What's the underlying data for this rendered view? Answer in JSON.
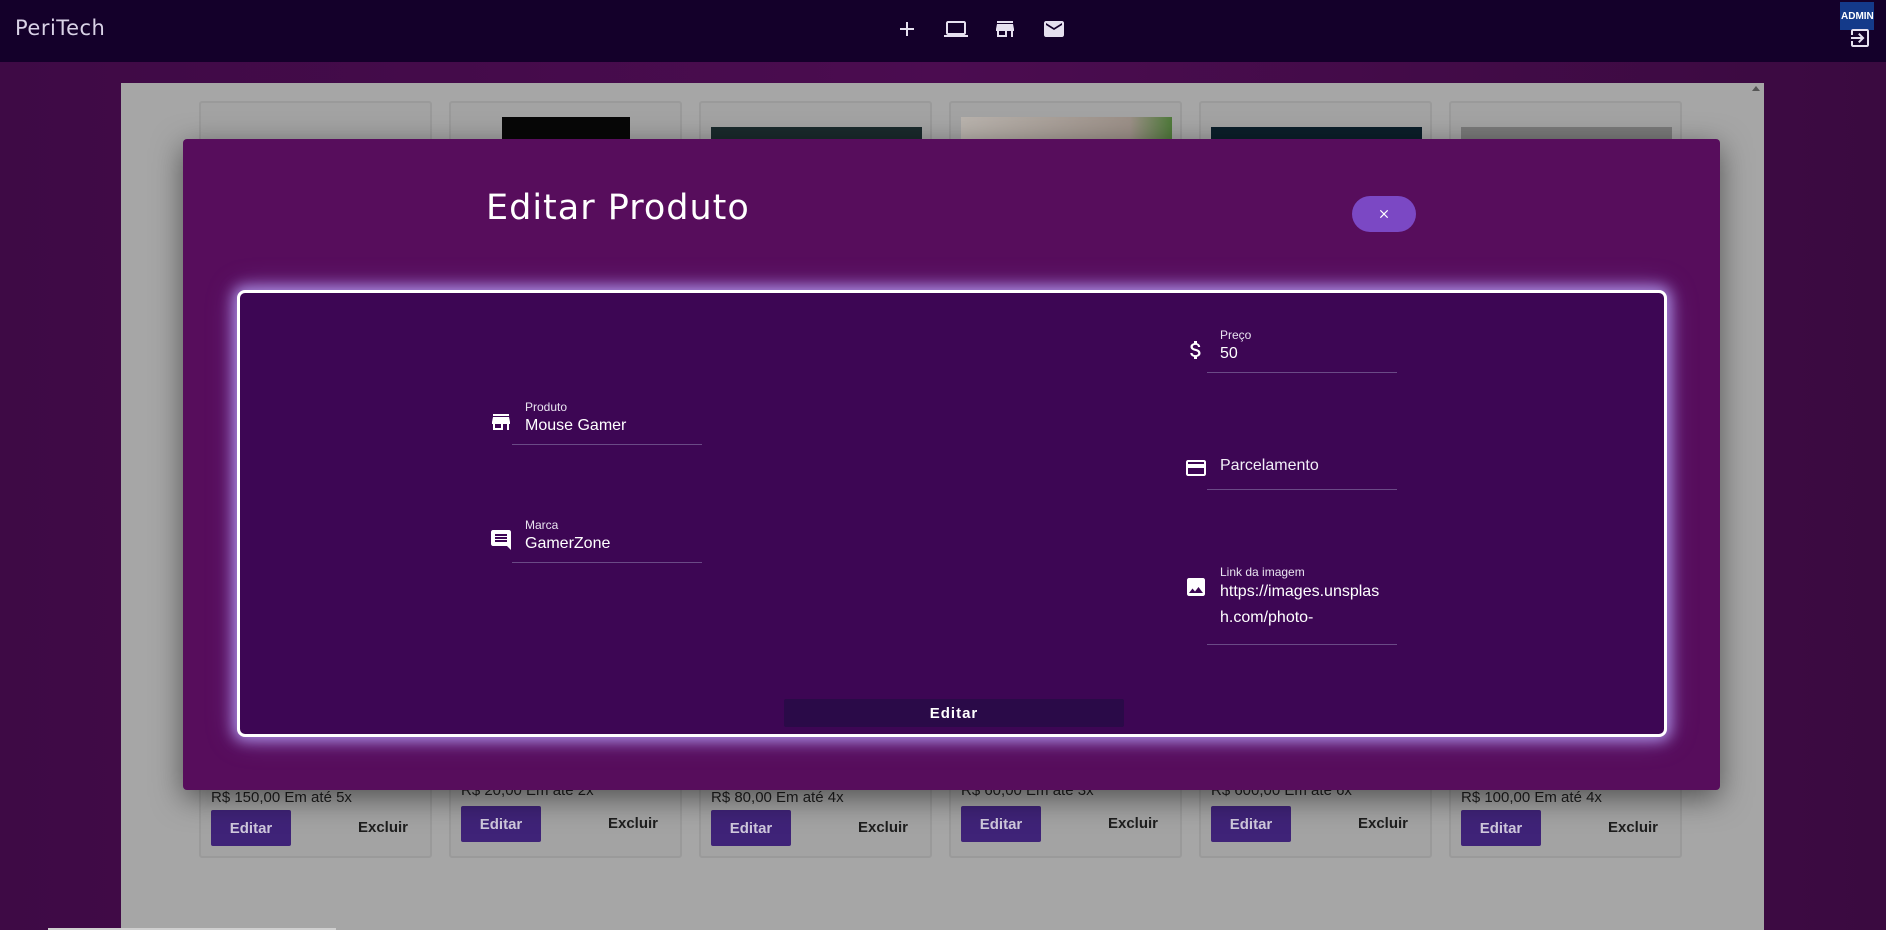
{
  "header": {
    "brand": "PeriTech",
    "nav_icons": [
      "add-icon",
      "laptop-icon",
      "store-icon",
      "mail-icon"
    ],
    "admin_badge": "ADMIN",
    "logout_icon": "logout-icon"
  },
  "products": [
    {
      "price_text": "R$ 150,00 Em até 5x",
      "edit_label": "Editar",
      "delete_label": "Excluir"
    },
    {
      "price_text": "R$ 20,00 Em até 2x",
      "edit_label": "Editar",
      "delete_label": "Excluir"
    },
    {
      "price_text": "R$ 80,00 Em até 4x",
      "edit_label": "Editar",
      "delete_label": "Excluir"
    },
    {
      "price_text": "R$ 60,00 Em até 3x",
      "edit_label": "Editar",
      "delete_label": "Excluir"
    },
    {
      "price_text": "R$ 600,00 Em até 6x",
      "edit_label": "Editar",
      "delete_label": "Excluir"
    },
    {
      "price_text": "R$ 100,00 Em até 4x",
      "edit_label": "Editar",
      "delete_label": "Excluir"
    }
  ],
  "modal": {
    "title": "Editar Produto",
    "close_icon": "close-icon",
    "fields": {
      "produto": {
        "label": "Produto",
        "value": "Mouse Gamer",
        "icon": "store-icon"
      },
      "marca": {
        "label": "Marca",
        "value": "GamerZone",
        "icon": "comment-icon"
      },
      "preco": {
        "label": "Preço",
        "value": "50",
        "icon": "dollar-icon"
      },
      "parcelamento": {
        "placeholder": "Parcelamento",
        "icon": "credit-card-icon"
      },
      "imagem": {
        "label": "Link da imagem",
        "value": "https://images.unsplash.com/photo-",
        "icon": "image-icon"
      }
    },
    "submit_label": "Editar"
  },
  "colors": {
    "topbar": "#14002a",
    "modal_bg": "#570d5c",
    "form_bg": "#3d0654",
    "close_button": "#7b48c4",
    "card_edit_button": "#3f2378"
  }
}
